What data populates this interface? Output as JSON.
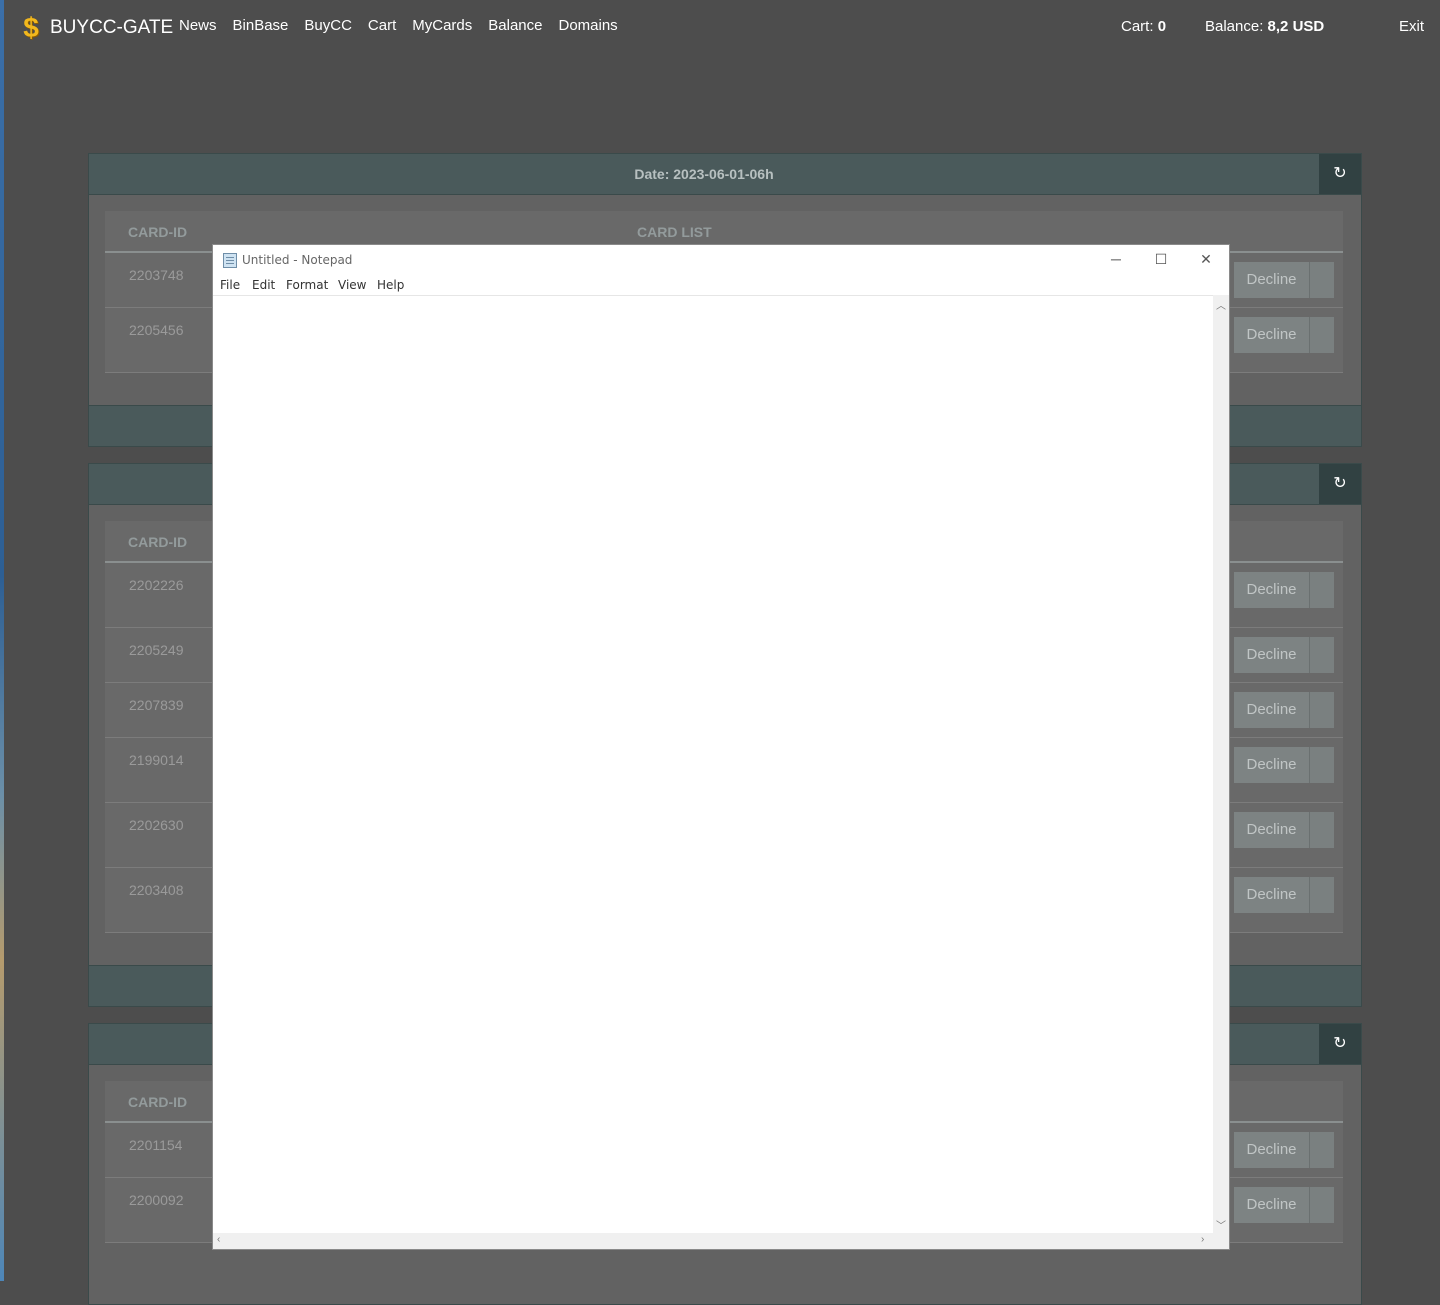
{
  "nav": {
    "brand": "BUYCC-GATE",
    "links": [
      "News",
      "BinBase",
      "BuyCC",
      "Cart",
      "MyCards",
      "Balance",
      "Domains"
    ],
    "cart_label": "Cart:",
    "cart_value": "0",
    "balance_label": "Balance:",
    "balance_value": "8,2 USD",
    "exit": "Exit"
  },
  "panels": [
    {
      "title": "Date: 2023-06-01-06h",
      "col_id": "CARD-ID",
      "col_list": "CARD LIST",
      "rows": [
        "2203748",
        "2205456"
      ]
    },
    {
      "title": "",
      "col_id": "CARD-ID",
      "col_list": "",
      "rows": [
        "2202226",
        "2205249",
        "2207839",
        "2199014",
        "2202630",
        "2203408"
      ]
    },
    {
      "title": "",
      "col_id": "CARD-ID",
      "col_list": "",
      "rows": [
        "2201154",
        "2200092"
      ]
    }
  ],
  "decline_label": "Decline",
  "notepad": {
    "title": "Untitled - Notepad",
    "menu": [
      "File",
      "Edit",
      "Format",
      "View",
      "Help"
    ],
    "content": ""
  },
  "colors": {
    "page_bg": "#4d4d4d",
    "panel_header": "#4a5a5b",
    "refresh_btn": "#314142",
    "decline_btn": "#7d8383",
    "brand_icon": "#f2b81d"
  }
}
